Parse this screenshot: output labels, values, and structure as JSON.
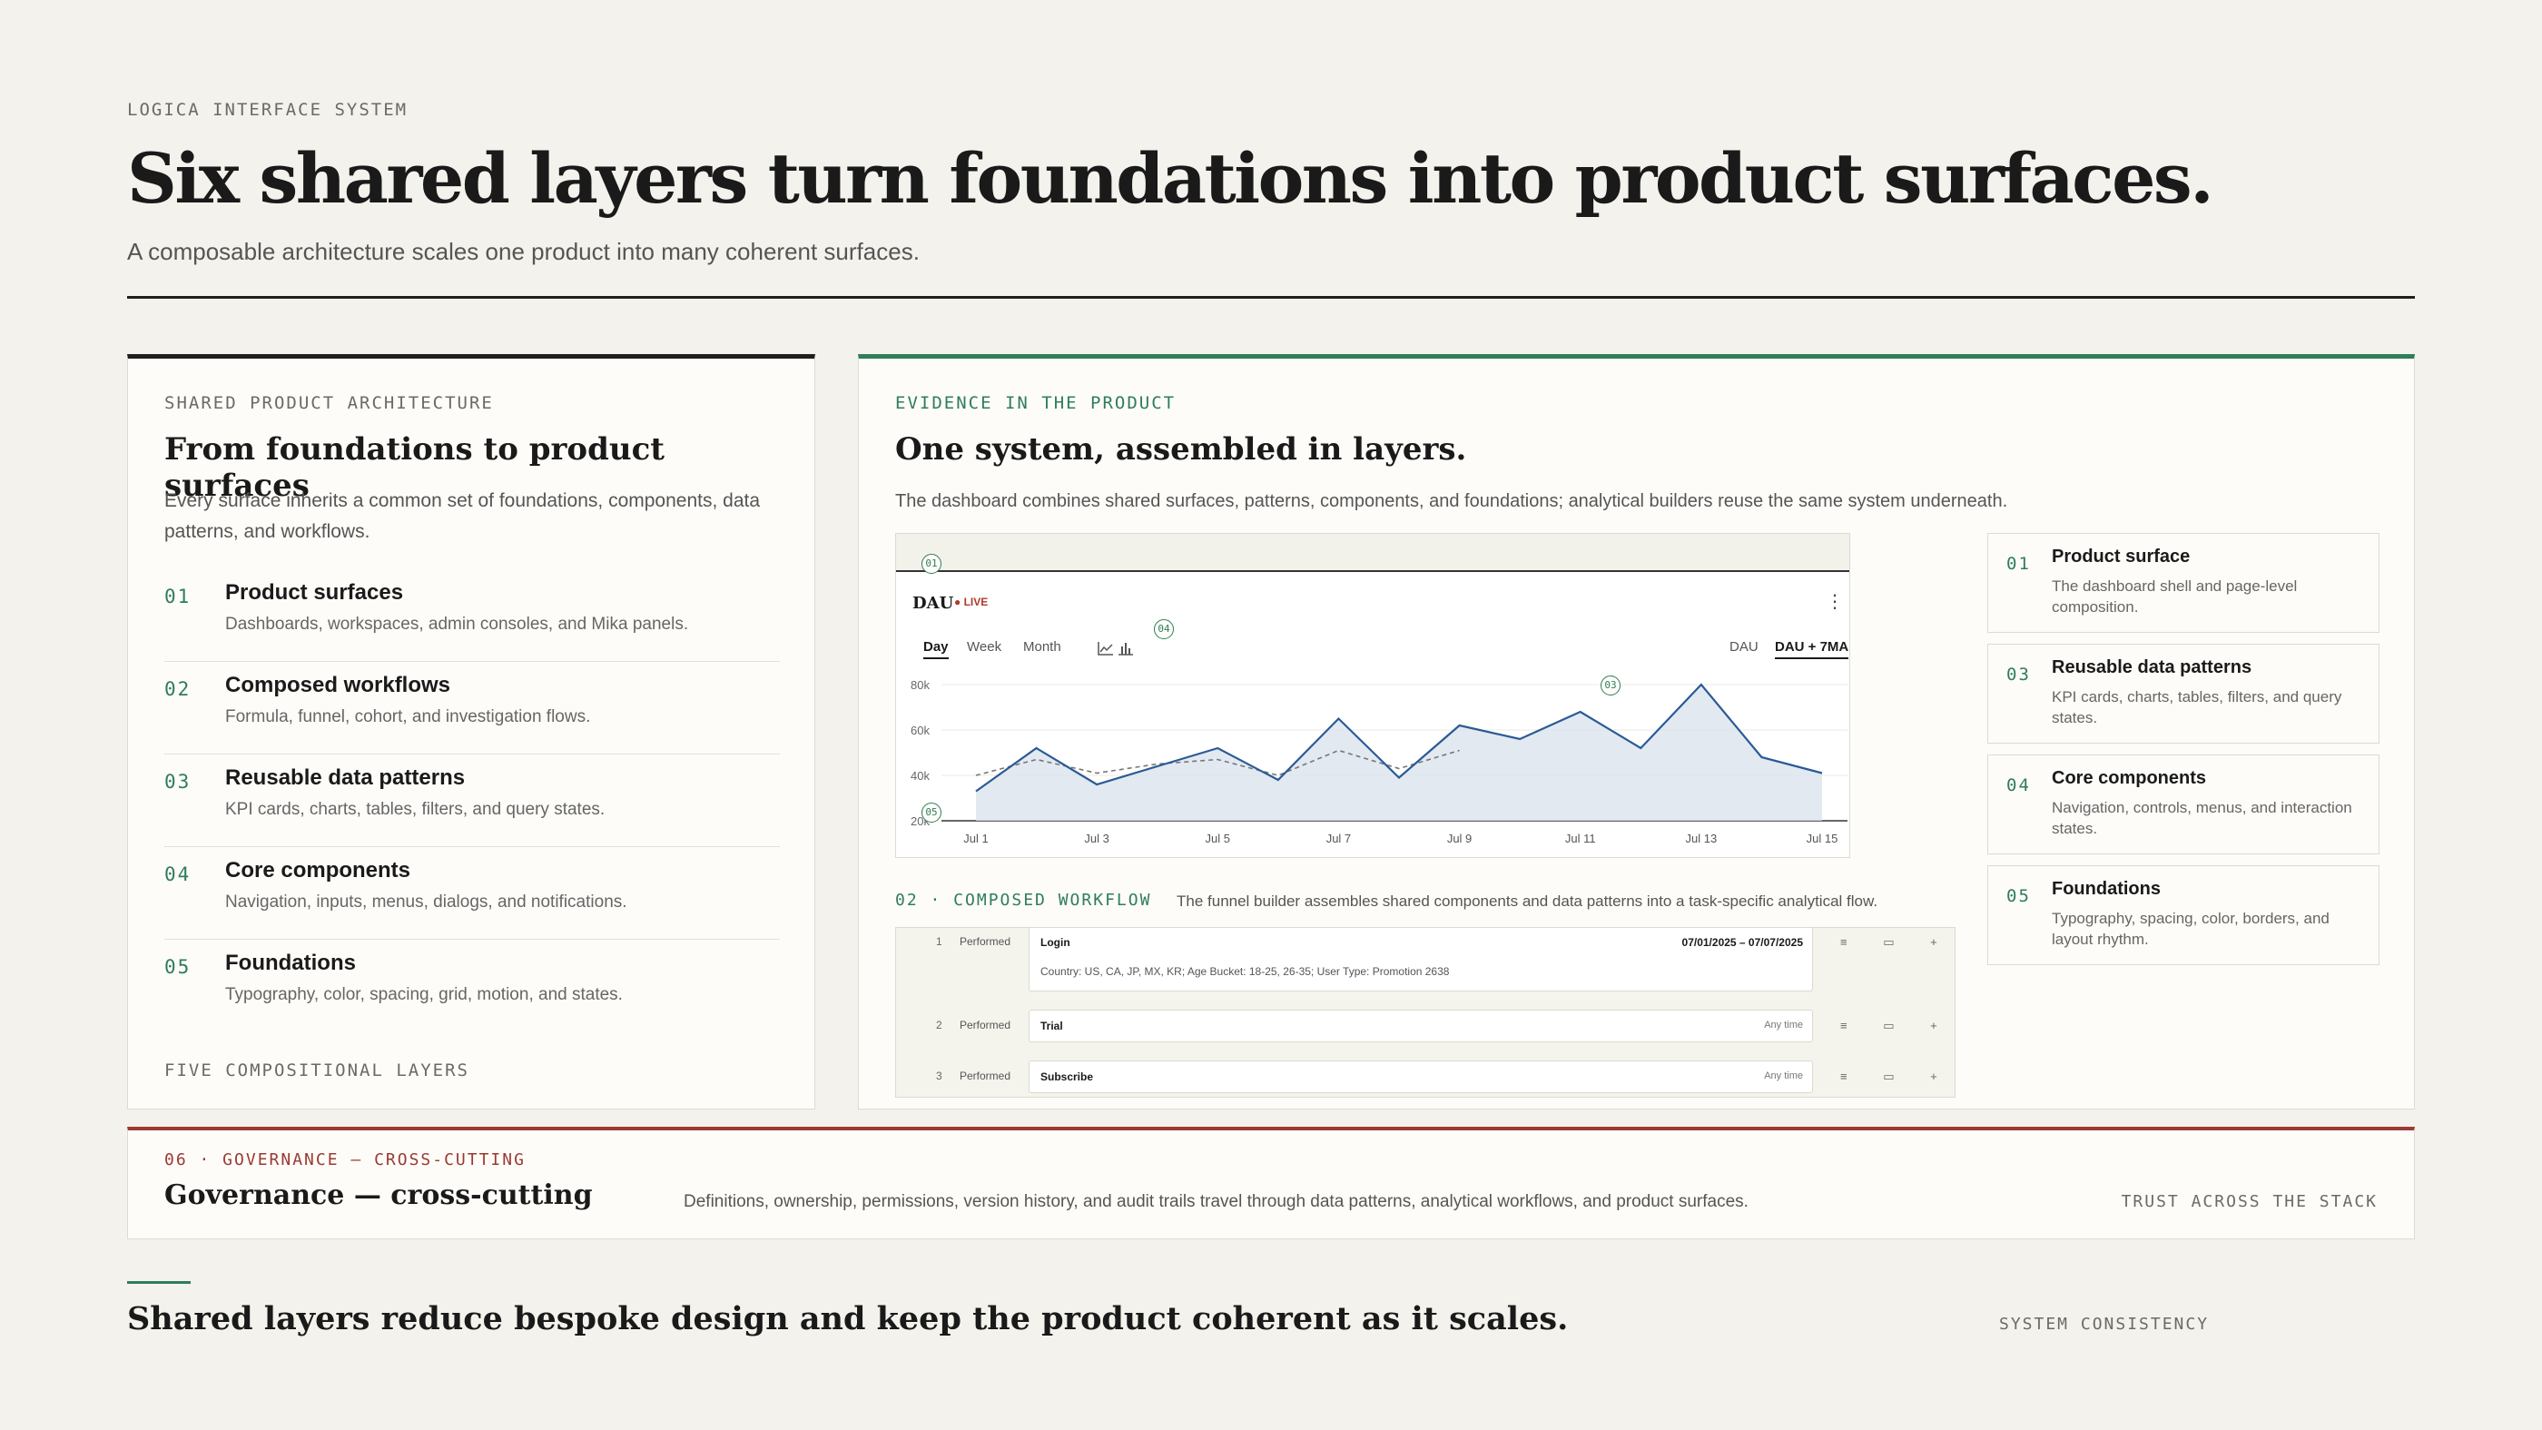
{
  "header": {
    "eyebrow": "LOGICA INTERFACE SYSTEM",
    "title": "Six shared layers turn foundations into product surfaces.",
    "subtitle": "A composable architecture scales one product into many coherent surfaces."
  },
  "architecture": {
    "eyebrow": "SHARED PRODUCT ARCHITECTURE",
    "title": "From foundations to product surfaces",
    "description": "Every surface inherits a common set of foundations, components, data patterns, and workflows.",
    "layers": [
      {
        "num": "01",
        "name": "Product surfaces",
        "desc": "Dashboards, workspaces, admin consoles, and Mika panels."
      },
      {
        "num": "02",
        "name": "Composed workflows",
        "desc": "Formula, funnel, cohort, and investigation flows."
      },
      {
        "num": "03",
        "name": "Reusable data patterns",
        "desc": "KPI cards, charts, tables, filters, and query states."
      },
      {
        "num": "04",
        "name": "Core components",
        "desc": "Navigation, inputs, menus, dialogs, and notifications."
      },
      {
        "num": "05",
        "name": "Foundations",
        "desc": "Typography, color, spacing, grid, motion, and states."
      }
    ],
    "footer": "FIVE COMPOSITIONAL LAYERS"
  },
  "evidence": {
    "eyebrow": "EVIDENCE IN THE PRODUCT",
    "title": "One system, assembled in layers.",
    "description": "The dashboard combines shared surfaces, patterns, components, and foundations; analytical builders reuse the same system underneath.",
    "dashboard": {
      "title": "DAU",
      "live": "● LIVE",
      "menu": "⋮",
      "ranges": [
        "Day",
        "Week",
        "Month"
      ],
      "toggles": [
        "DAU",
        "DAU + 7MA"
      ],
      "markers": [
        "01",
        "04",
        "03",
        "05"
      ]
    },
    "workflow": {
      "label": "02 · COMPOSED WORKFLOW",
      "desc": "The funnel builder assembles shared components and data patterns into a task-specific analytical flow.",
      "steps": [
        {
          "num": "1",
          "verb": "Performed",
          "event": "Login",
          "time": "07/01/2025 – 07/07/2025",
          "filter": "Country: US, CA, JP, MX, KR; Age Bucket: 18-25, 26-35; User Type: Promotion 2638"
        },
        {
          "num": "2",
          "verb": "Performed",
          "event": "Trial",
          "time": "Any time"
        },
        {
          "num": "3",
          "verb": "Performed",
          "event": "Subscribe",
          "time": "Any time"
        }
      ],
      "icons": "≡ ▭ +"
    },
    "annotations": [
      {
        "num": "01",
        "name": "Product surface",
        "desc": "The dashboard shell and page-level composition."
      },
      {
        "num": "03",
        "name": "Reusable data patterns",
        "desc": "KPI cards, charts, tables, filters, and query states."
      },
      {
        "num": "04",
        "name": "Core components",
        "desc": "Navigation, controls, menus, and interaction states."
      },
      {
        "num": "05",
        "name": "Foundations",
        "desc": "Typography, spacing, color, borders, and layout rhythm."
      }
    ]
  },
  "governance": {
    "eyebrow": "06 · GOVERNANCE — CROSS-CUTTING",
    "title": "Governance — cross-cutting",
    "description": "Definitions, ownership, permissions, version history, and audit trails travel through data patterns, analytical workflows, and product surfaces.",
    "tag": "TRUST ACROSS THE STACK"
  },
  "footer": {
    "text": "Shared layers reduce bespoke design and keep the product coherent as it scales.",
    "tag": "SYSTEM CONSISTENCY"
  },
  "chart_data": {
    "type": "line",
    "title": "DAU",
    "x": [
      "Jul 1",
      "Jul 2",
      "Jul 3",
      "Jul 4",
      "Jul 5",
      "Jul 6",
      "Jul 7",
      "Jul 8",
      "Jul 9",
      "Jul 10",
      "Jul 11",
      "Jul 12",
      "Jul 13",
      "Jul 14",
      "Jul 15"
    ],
    "xticks": [
      "Jul 1",
      "Jul 3",
      "Jul 5",
      "Jul 7",
      "Jul 9",
      "Jul 11",
      "Jul 13",
      "Jul 15"
    ],
    "yticks": [
      "20k",
      "40k",
      "60k",
      "80k"
    ],
    "ylim": [
      20000,
      85000
    ],
    "series": [
      {
        "name": "DAU",
        "values": [
          33000,
          52000,
          36000,
          44000,
          52000,
          38000,
          65000,
          39000,
          62000,
          56000,
          68000,
          52000,
          80000,
          48000,
          41000
        ]
      },
      {
        "name": "DAU + 7MA",
        "values": [
          40000,
          47000,
          41000,
          45000,
          47000,
          40000,
          51000,
          43000,
          51000
        ]
      }
    ],
    "colors": {
      "DAU": "#2b5a96",
      "DAU + 7MA": "#777777",
      "area": "#dbe3ee"
    }
  }
}
